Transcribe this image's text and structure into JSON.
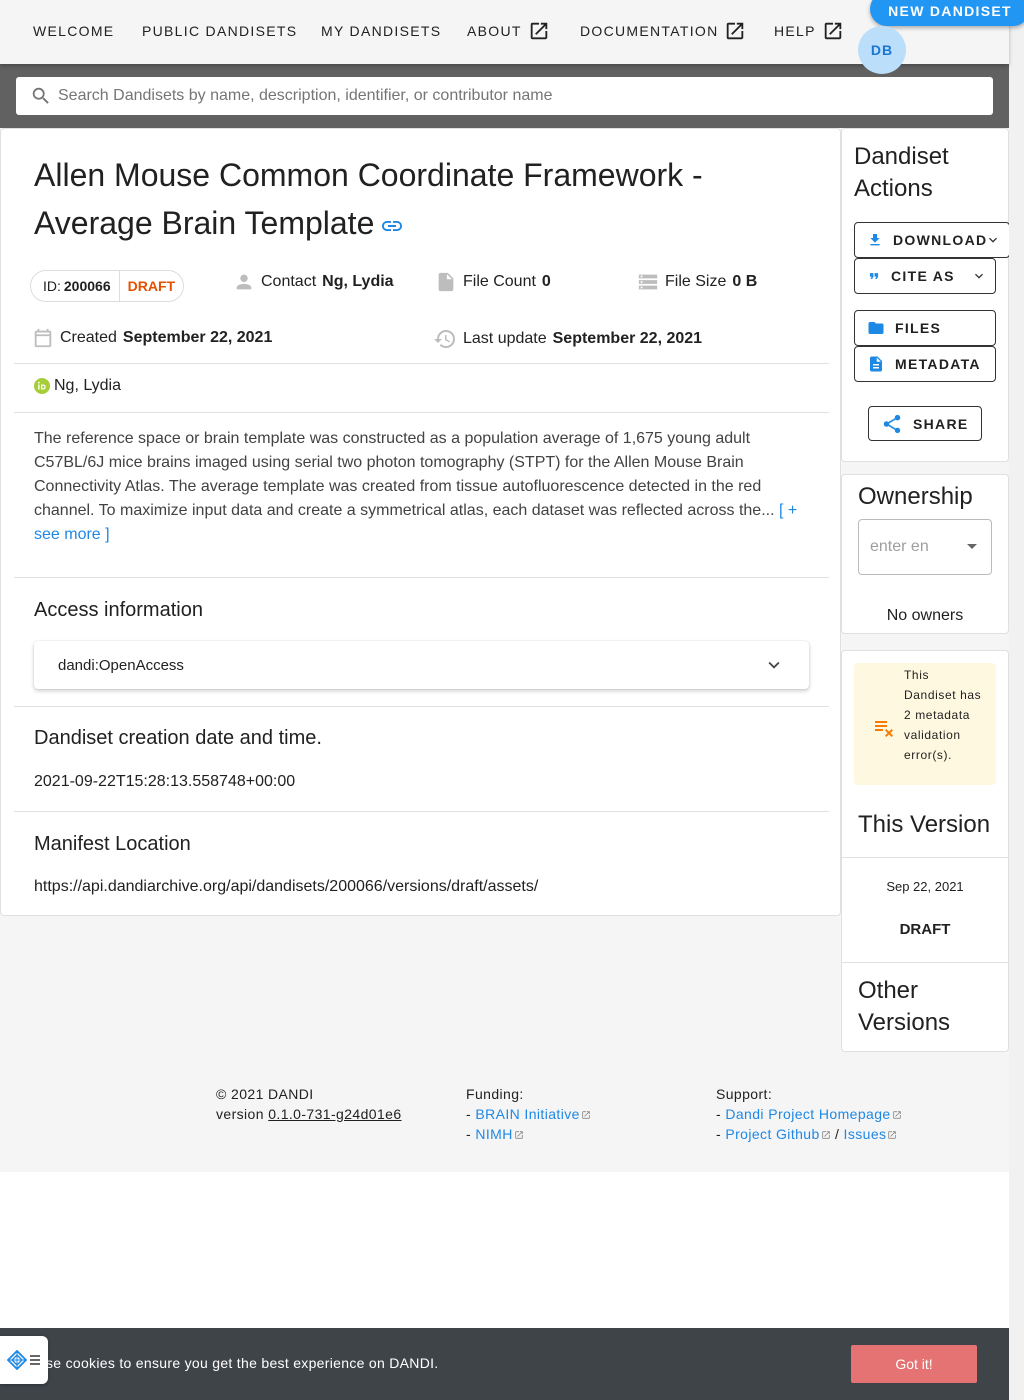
{
  "nav": {
    "welcome": "WELCOME",
    "public": "PUBLIC DANDISETS",
    "my": "MY DANDISETS",
    "about": "ABOUT",
    "documentation": "DOCUMENTATION",
    "help": "HELP",
    "new_dandiset": "NEW DANDISET",
    "avatar": "DB"
  },
  "search": {
    "placeholder": "Search Dandisets by name, description, identifier, or contributor name"
  },
  "dandiset": {
    "title": "Allen Mouse Common Coordinate Framework - Average Brain Template",
    "id_label": "ID:",
    "id": "200066",
    "status": "DRAFT",
    "contact_label": "Contact",
    "contact": "Ng, Lydia",
    "file_count_label": "File Count",
    "file_count": "0",
    "file_size_label": "File Size",
    "file_size": "0 B",
    "created_label": "Created",
    "created": "September 22, 2021",
    "updated_label": "Last update",
    "updated": "September 22, 2021",
    "contributor": "Ng, Lydia",
    "description": "The reference space or brain template was constructed as a population average of 1,675 young adult C57BL/6J mice brains imaged using serial two photon tomography (STPT) for the Allen Mouse Brain Connectivity Atlas. The average template was created from tissue autofluorescence detected in the red channel. To maximize input data and create a symmetrical atlas, each dataset was reflected across the...",
    "see_more": "[ + see more ]",
    "access_title": "Access information",
    "access_value": "dandi:OpenAccess",
    "creation_title": "Dandiset creation date and time.",
    "creation_value": "2021-09-22T15:28:13.558748+00:00",
    "manifest_title": "Manifest Location",
    "manifest_value": "https://api.dandiarchive.org/api/dandisets/200066/versions/draft/assets/"
  },
  "actions": {
    "title": "Dandiset Actions",
    "download": "DOWNLOAD",
    "cite": "CITE AS",
    "files": "FILES",
    "metadata": "METADATA",
    "share": "SHARE"
  },
  "ownership": {
    "title": "Ownership",
    "placeholder": "enter en",
    "no_owners": "No owners"
  },
  "versions": {
    "warning": "This Dandiset has 2 metadata validation error(s).",
    "this_version": "This Version",
    "date": "Sep 22, 2021",
    "status": "DRAFT",
    "other_versions": "Other Versions"
  },
  "footer": {
    "copyright": "© 2021 DANDI",
    "version_label": "version",
    "version": "0.1.0-731-g24d01e6",
    "funding_label": "Funding:",
    "funding_1": "BRAIN Initiative",
    "funding_2": "NIMH",
    "support_label": "Support:",
    "support_1": "Dandi Project Homepage",
    "support_2": "Project Github",
    "support_3": "Issues"
  },
  "cookie": {
    "text": "se cookies to ensure you get the best experience on DANDI.",
    "button": "Got it!"
  },
  "colors": {
    "primary": "#2196f3",
    "draft": "#e65100",
    "link": "#1e88e5",
    "warning_bg": "#fff8e1",
    "warning_icon": "#f57c00",
    "cookie_bg": "#3f4449",
    "cookie_btn": "#e57373"
  }
}
